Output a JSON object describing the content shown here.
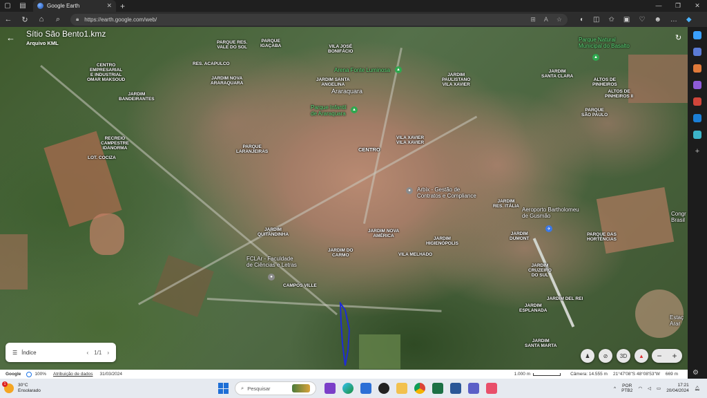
{
  "browser": {
    "tab_title": "Google Earth",
    "url": "https://earth.google.com/web/"
  },
  "panel": {
    "title": "Sítio São Bento1.kmz",
    "subtitle": "Arquivo KML",
    "index_label": "Índice",
    "page": "1/1"
  },
  "map_labels": [
    {
      "text": "PARQUE RES.\nVALE DO SOL",
      "key": "vale-do-sol"
    },
    {
      "text": "PARQUE\nIGAÇABA",
      "key": "igacaba"
    },
    {
      "text": "VILA JOSÉ\nBONIFÁCIO",
      "key": "jose-bonifacio"
    },
    {
      "text": "CENTRO\nEMPRESARIAL\nE INDUSTRIAL\nOMAR MAKSOUD",
      "key": "centro-empresarial"
    },
    {
      "text": "RES. ACAPULCO",
      "key": "acapulco"
    },
    {
      "text": "JARDIM\nBANDEIRANTES",
      "key": "bandeirantes"
    },
    {
      "text": "JARDIM NOVA\nARARAQUARA",
      "key": "nova-araraquara"
    },
    {
      "text": "JARDIM SANTA\nANGELINA",
      "key": "santa-angelina"
    },
    {
      "text": "JARDIM\nPAULISTANO\nVILA XAVIER",
      "key": "paulistano"
    },
    {
      "text": "JARDIM\nSANTA CLARA",
      "key": "santa-clara"
    },
    {
      "text": "ALTOS DE\nPINHEIROS",
      "key": "altos-pinheiros"
    },
    {
      "text": "ALTOS DE\nPINHEIROS II",
      "key": "altos-pinheiros-2"
    },
    {
      "text": "PARQUE\nSÃO PAULO",
      "key": "sao-paulo"
    },
    {
      "text": "RECREIO\nCAMPESTRE\nIDANORMA",
      "key": "idanorma"
    },
    {
      "text": "PARQUE\nLARANJEIRAS",
      "key": "laranjeiras"
    },
    {
      "text": "CENTRO",
      "key": "centro"
    },
    {
      "text": "VILA XAVIER\nVILA XAVIER",
      "key": "vila-xavier"
    },
    {
      "text": "LOT. COCIZA",
      "key": "cociza"
    },
    {
      "text": "JARDIM\nRES. ITÁLIA",
      "key": "res-italia"
    },
    {
      "text": "JARDIM\nQUITANDINHA",
      "key": "quitandinha"
    },
    {
      "text": "JARDIM NOVA\nAMÉRICA",
      "key": "nova-america"
    },
    {
      "text": "JARDIM\nHIGIENÓPOLIS",
      "key": "higienopolis"
    },
    {
      "text": "JARDIM\nDUMONT",
      "key": "dumont"
    },
    {
      "text": "PARQUE DAS\nHORTÊNCIAS",
      "key": "hortencias"
    },
    {
      "text": "JARDIM DO\nCARMO",
      "key": "carmo"
    },
    {
      "text": "VILA MELHADO",
      "key": "melhado"
    },
    {
      "text": "JARDIM\nCRUZEIRO\nDO SUL",
      "key": "cruzeiro"
    },
    {
      "text": "CAMPOS VILLE",
      "key": "campos-ville"
    },
    {
      "text": "JARDIM DEL REI",
      "key": "del-rei"
    },
    {
      "text": "JARDIM\nESPLANADA",
      "key": "esplanada"
    },
    {
      "text": "JARDIM\nSANTA MARTA",
      "key": "santa-marta"
    },
    {
      "text": "Congr\nBrasil",
      "key": "congr"
    },
    {
      "text": "Estaç\nArar",
      "key": "estac"
    }
  ],
  "poi_labels": [
    {
      "text": "Parque Natural\nMunicipal do Basalto",
      "key": "basalto",
      "green": true
    },
    {
      "text": "Arena Fonte Luminosa",
      "key": "arena",
      "green": true
    },
    {
      "text": "Araraquara",
      "key": "araraquara",
      "green": false
    },
    {
      "text": "Parque Infantil\nde Araraquara",
      "key": "parque-infantil",
      "green": true
    },
    {
      "text": "Arbix - Gestão de\nContratos e Compliance",
      "key": "arbix",
      "green": false
    },
    {
      "text": "Aeroporto Bartholomeu\nde Gusmão",
      "key": "aeroporto",
      "green": false
    },
    {
      "text": "FCLAr - Faculdade\nde Ciências e Letras",
      "key": "fclar",
      "green": false
    }
  ],
  "controls": {
    "view_3d": "3D"
  },
  "status": {
    "brand": "Google",
    "quality": "100%",
    "attribution": "Atribuição de dados",
    "date": "31/03/2024",
    "scale": "1.000 m",
    "camera": "Câmera: 14.555 m",
    "coords": "21°47'08\"S 48°08'53\"W",
    "elevation": "669 m"
  },
  "taskbar": {
    "temp": "30°C",
    "weather": "Ensolarado",
    "weather_badge": "1",
    "search_placeholder": "Pesquisar",
    "lang_line1": "POR",
    "lang_line2": "PTB2",
    "time": "17:21",
    "date": "20/04/2024"
  },
  "colors": {
    "polygon": "#1d2bd6",
    "accent": "#1a73e8"
  }
}
